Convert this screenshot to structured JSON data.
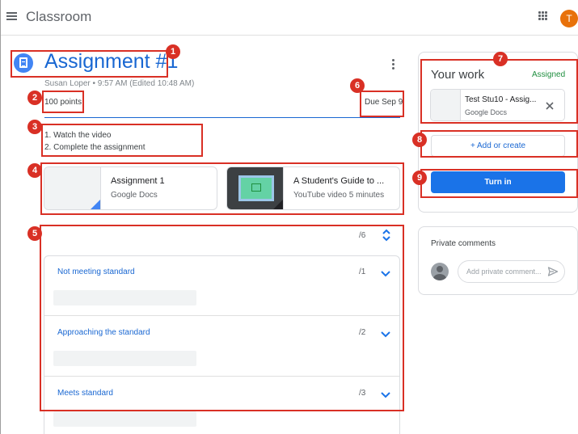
{
  "app": {
    "title": "Classroom",
    "avatar_letter": "T"
  },
  "assignment": {
    "title": "Assignment #1",
    "byline": "Susan Loper • 9:57 AM (Edited 10:48 AM)",
    "points": "100 points",
    "due": "Due Sep 9",
    "instructions": [
      "1. Watch the video",
      "2. Complete the assignment"
    ]
  },
  "attachments": [
    {
      "name": "Assignment 1",
      "type": "Google Docs"
    },
    {
      "name": "A Student's Guide to ...",
      "type": "YouTube video  5 minutes"
    }
  ],
  "rubric": {
    "total": "/6",
    "criteria": [
      {
        "name": "Not meeting standard",
        "points": "/1"
      },
      {
        "name": "Approaching the standard",
        "points": "/2"
      },
      {
        "name": "Meets standard",
        "points": "/3"
      }
    ]
  },
  "your_work": {
    "title": "Your work",
    "status": "Assigned",
    "file_name": "Test Stu10 - Assig...",
    "file_type": "Google Docs",
    "add_label": "+  Add or create",
    "turn_in_label": "Turn in"
  },
  "private_comments": {
    "title": "Private comments",
    "placeholder": "Add private comment..."
  },
  "annotations": [
    "1",
    "2",
    "3",
    "4",
    "5",
    "6",
    "7",
    "8",
    "9"
  ],
  "colors": {
    "brand_blue": "#1967d2",
    "button_blue": "#1a73e8",
    "status_green": "#1e8e3e",
    "annotation_red": "#d93025",
    "avatar_orange": "#e8710a"
  },
  "icons": [
    "menu-icon",
    "apps-grid-icon",
    "assignment-icon",
    "more-vert-icon",
    "unfold-icon",
    "chevron-down-icon",
    "close-icon",
    "send-icon"
  ]
}
